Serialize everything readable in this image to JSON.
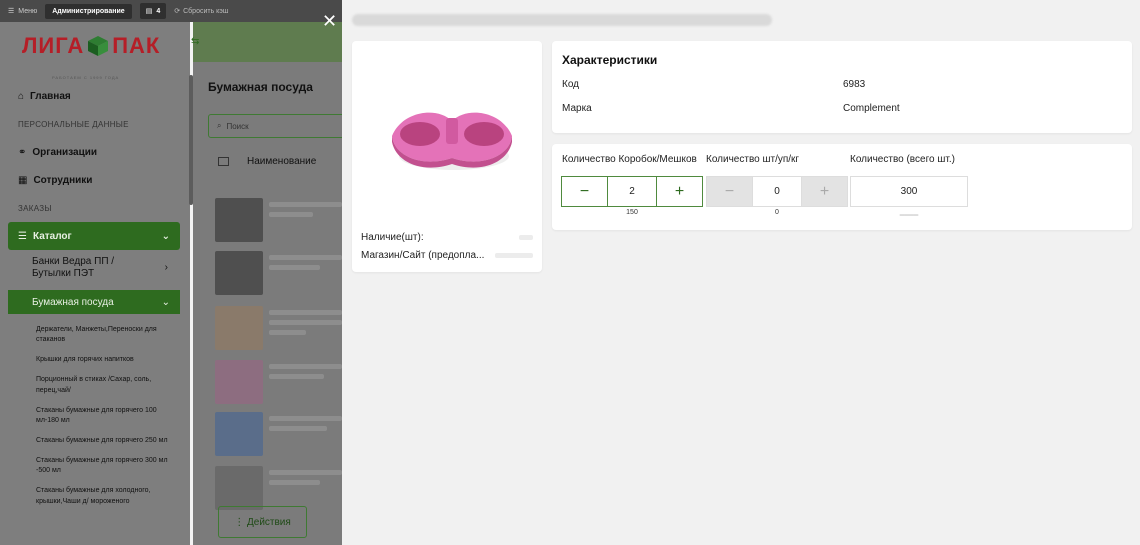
{
  "topbar": {
    "menu_label": "Меню",
    "admin_label": "Администрирование",
    "badge_count": "4",
    "reset_label": "Сбросить кэш"
  },
  "brand": {
    "logo_left": "ЛИГА",
    "logo_right": "ПАК",
    "logo_sub": "РАБОТАЕМ С 1999 ГОДА",
    "accent": "#b51e27",
    "primary": "#2e6b1f"
  },
  "sidebar": {
    "home": "Главная",
    "section_personal": "ПЕРСОНАЛЬНЫЕ ДАННЫЕ",
    "organizations": "Организации",
    "employees": "Сотрудники",
    "section_orders": "ЗАКАЗЫ",
    "catalog": "Каталог",
    "cat_cans": "Банки Ведра ПП / Бутылки ПЭТ",
    "cat_paper": "Бумажная посуда",
    "leaves": [
      "Держатели, Манжеты,Переноски для стаканов",
      "Крышки для горячих напитков",
      "Порционный в стиках /Сахар, соль, перец,чай/",
      "Стаканы бумажные для горячего 100 мл-180 мл",
      "Стаканы бумажные для горячего 250 мл",
      "Стаканы бумажные для горячего 300 мл -500 мл",
      "Стаканы бумажные для холодного, крышки,Чаши д/ мороженого"
    ]
  },
  "main": {
    "title": "Бумажная посуда",
    "search_placeholder": "Поиск",
    "col_name": "Наименование",
    "actions_label": "⋮ Действия"
  },
  "modal": {
    "stock_label": "Наличие(шт):",
    "shop_label": "Магазин/Сайт (предопла...",
    "characteristics_title": "Характеристики",
    "chars": [
      {
        "key": "Код",
        "value": "6983"
      },
      {
        "key": "Марка",
        "value": "Complement"
      }
    ],
    "qty_boxes_label": "Количество Коробок/Мешков",
    "qty_units_label": "Количество шт/уп/кг",
    "qty_total_label": "Количество (всего шт.)",
    "qty_boxes_value": "2",
    "qty_units_value": "0",
    "qty_total_value": "300",
    "boxes_sub": "150",
    "units_sub": "0"
  }
}
